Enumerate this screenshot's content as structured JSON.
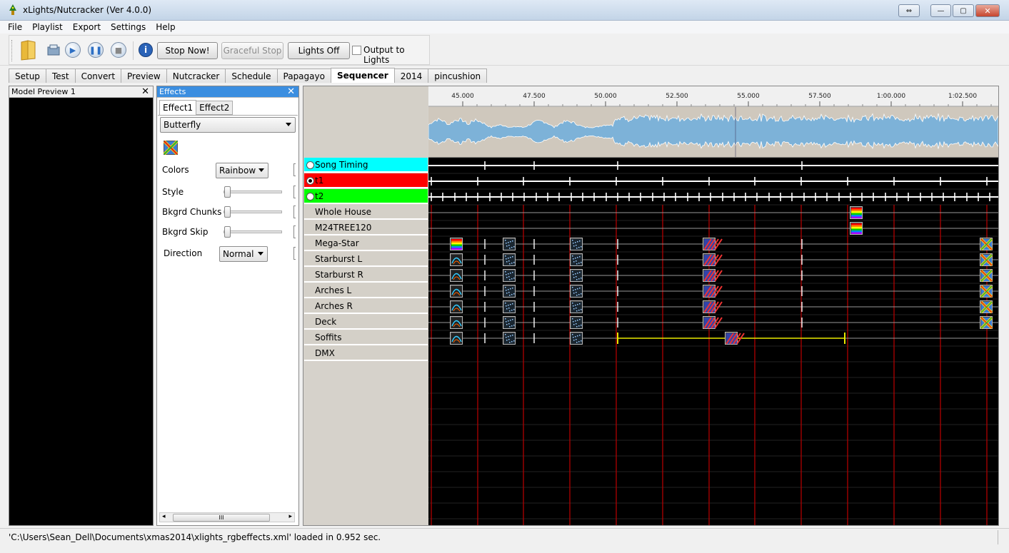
{
  "window": {
    "title": "xLights/Nutcracker (Ver 4.0.0)",
    "controls": [
      "⇔",
      "—",
      "▢",
      "✕"
    ]
  },
  "menu": [
    "File",
    "Playlist",
    "Export",
    "Settings",
    "Help"
  ],
  "toolbar": {
    "stop_now": "Stop Now!",
    "graceful_stop": "Graceful Stop",
    "lights_off": "Lights Off",
    "output_to_lights": "Output to Lights",
    "output_checked": false
  },
  "tabs": [
    "Setup",
    "Test",
    "Convert",
    "Preview",
    "Nutcracker",
    "Schedule",
    "Papagayo",
    "Sequencer",
    "2014",
    "pincushion"
  ],
  "active_tab": "Sequencer",
  "model_preview": {
    "title": "Model Preview 1",
    "close": "✕"
  },
  "effects_panel": {
    "title": "Effects",
    "close": "✕",
    "tabs": [
      "Effect1",
      "Effect2"
    ],
    "effect": "Butterfly",
    "labels": {
      "colors": "Colors",
      "style": "Style",
      "bkgrd_chunks": "Bkgrd Chunks",
      "bkgrd_skip": "Bkgrd Skip",
      "direction": "Direction"
    },
    "colors_value": "Rainbow",
    "direction_value": "Normal",
    "slider_levels": {
      "style": 0,
      "bkgrd_chunks": 0,
      "bkgrd_skip": 0
    },
    "scroll_grip": "III"
  },
  "sequencer": {
    "time_ticks": [
      "45.000",
      "47.500",
      "50.000",
      "52.500",
      "55.000",
      "57.500",
      "1:00.000",
      "1:02.500"
    ],
    "timing_rows": [
      {
        "label": "Song Timing",
        "color": "#00ffff",
        "selected": false
      },
      {
        "label": "t1",
        "color": "#ff0000",
        "selected": true
      },
      {
        "label": "t2",
        "color": "#00ff00",
        "selected": false
      }
    ],
    "models": [
      "Whole House",
      "M24TREE120",
      "Mega-Star",
      "Starburst L",
      "Starburst R",
      "Arches L",
      "Arches R",
      "Deck",
      "Soffits",
      "DMX"
    ]
  },
  "status": {
    "message": "'C:\\Users\\Sean_Dell\\Documents\\xmas2014\\xlights_rgbeffects.xml' loaded in 0.952 sec."
  },
  "colors": {
    "waveform": "#7db2d8",
    "waveform_bg": "#cfc8bd",
    "grid_bg": "#000000",
    "timing_line_red": "#b00000",
    "selected_effect_line": "#e8e800",
    "effects_header": "#3b8ee0"
  }
}
